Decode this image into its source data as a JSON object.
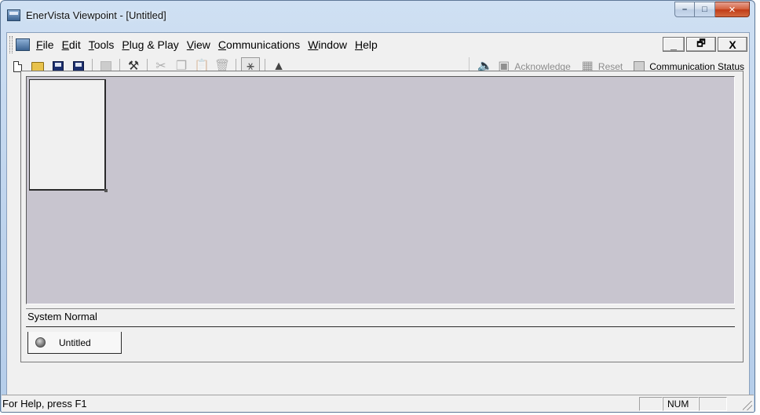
{
  "window": {
    "title": "EnerVista Viewpoint - [Untitled]",
    "caption_buttons": {
      "minimize": "–",
      "maximize": "□",
      "close": "✕"
    }
  },
  "menubar": {
    "items": [
      {
        "label": "File"
      },
      {
        "label": "Edit"
      },
      {
        "label": "Tools"
      },
      {
        "label": "Plug & Play"
      },
      {
        "label": "View"
      },
      {
        "label": "Communications"
      },
      {
        "label": "Window"
      },
      {
        "label": "Help"
      }
    ],
    "mdi_buttons": {
      "minimize": "_",
      "restore": "🗗",
      "close": "X"
    }
  },
  "toolbar": {
    "left_icons": [
      "new-icon",
      "open-icon",
      "save-icon",
      "save-all-icon",
      "properties-icon",
      "import-icon",
      "cut-icon",
      "copy-icon",
      "paste-icon",
      "delete-icon",
      "plug-and-play-icon",
      "alarm-icon"
    ],
    "right": {
      "acknowledge_label": "Acknowledge",
      "reset_label": "Reset",
      "communication_status_label": "Communication Status"
    }
  },
  "workspace": {
    "system_status": "System Normal",
    "tab_label": "Untitled"
  },
  "statusbar": {
    "help_text": "For Help, press F1",
    "num_indicator": "NUM"
  }
}
